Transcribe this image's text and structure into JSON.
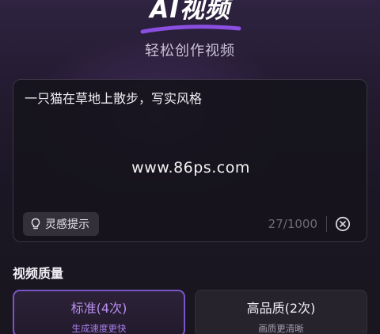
{
  "header": {
    "app_title": "AI视频",
    "subtitle": "轻松创作视频",
    "accent_color": "#8a4fe0"
  },
  "prompt": {
    "text": "一只猫在草地上散步，写实风格",
    "watermark": "www.86ps.com",
    "inspire_button_label": "灵感提示",
    "inspire_icon": "lightbulb-icon",
    "char_count": "27/1000",
    "clear_icon": "clear-circle-icon"
  },
  "quality": {
    "section_title": "视频质量",
    "options": [
      {
        "label": "标准(4次)",
        "sub": "生成速度更快",
        "selected": true
      },
      {
        "label": "高品质(2次)",
        "sub": "画质更清晰",
        "selected": false
      }
    ]
  }
}
